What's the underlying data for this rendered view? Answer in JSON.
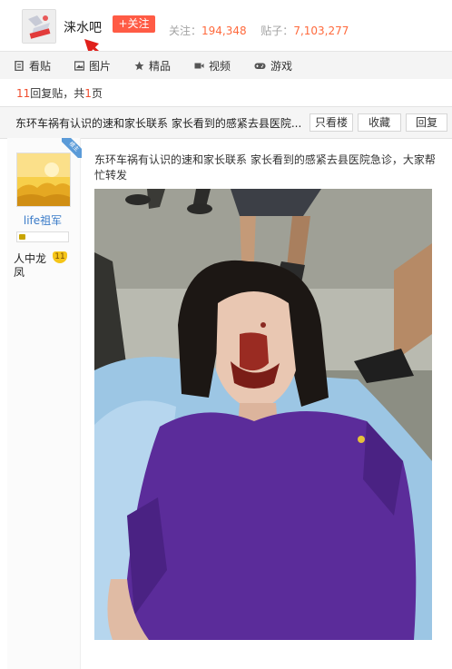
{
  "header": {
    "bar_name": "涞水吧",
    "follow_label": "+关注",
    "follow_stat_label": "关注：",
    "follow_stat_value": "194,348",
    "posts_stat_label": "贴子：",
    "posts_stat_value": "7,103,277"
  },
  "tabs": [
    {
      "label": "看贴",
      "icon": "document-icon"
    },
    {
      "label": "图片",
      "icon": "image-icon"
    },
    {
      "label": "精品",
      "icon": "star-icon"
    },
    {
      "label": "视频",
      "icon": "video-icon"
    },
    {
      "label": "游戏",
      "icon": "gamepad-icon"
    }
  ],
  "reply_info": {
    "count": "11",
    "suffix": "回复贴，共",
    "pages": "1",
    "pages_unit": "页"
  },
  "thread": {
    "title": "东环车祸有认识的速和家长联系 家长看到的感紧去县医院...",
    "buttons": {
      "only_op": "只看楼主",
      "collect": "收藏",
      "reply": "回复"
    }
  },
  "post": {
    "author": "life祖军",
    "level_name": "人中龙凤",
    "level_number": "11",
    "corner_label": "楼主",
    "text": "东环车祸有认识的速和家长联系 家长看到的感紧去县医院急诊，大家帮忙转发"
  },
  "colors": {
    "accent": "#ff5b45",
    "stat_number": "#ff6a3d",
    "link": "#3a7bc8"
  }
}
